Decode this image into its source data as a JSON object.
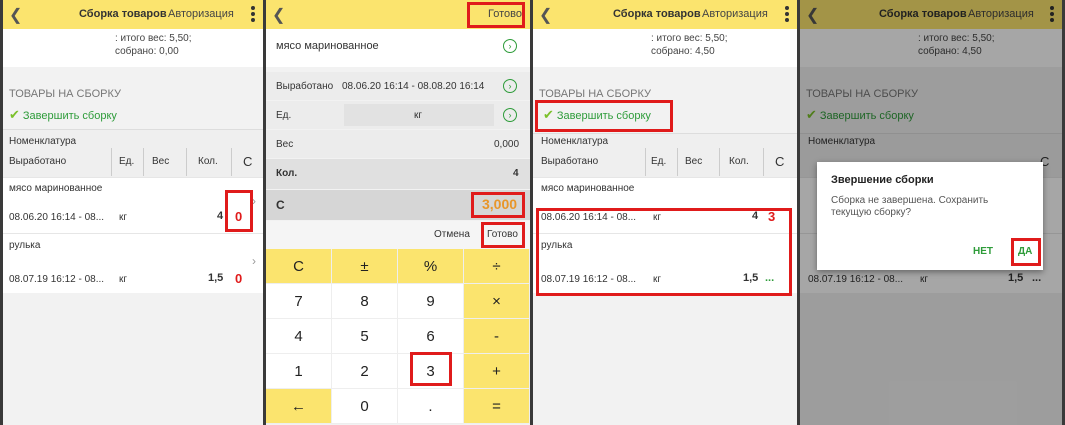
{
  "header": {
    "title": "Сборка товаров",
    "auth": "Авторизация",
    "done": "Готово"
  },
  "summary_before": {
    "line1": ": итого вес: 5,50;",
    "line2": "собрано: 0,00"
  },
  "summary_after": {
    "line1": ": итого вес: 5,50;",
    "line2": "собрано: 4,50"
  },
  "section_title": "ТОВАРЫ НА СБОРКУ",
  "finish_label": "Завершить сборку",
  "columns": {
    "nomenclature": "Номенклатура",
    "produced": "Выработано",
    "unit": "Ед.",
    "weight": "Вес",
    "qty": "Кол.",
    "c": "С"
  },
  "items": [
    {
      "name": "мясо маринованное",
      "period": "08.06.20 16:14 - 08...",
      "unit": "кг",
      "qty": "4",
      "collected_before": "0",
      "collected_after": "3"
    },
    {
      "name": "рулька",
      "period": "08.07.19 16:12 - 08...",
      "unit": "кг",
      "qty": "1,5",
      "collected_before": "0",
      "collected_after": "..."
    }
  ],
  "calc": {
    "product": "мясо маринованное",
    "produced_label": "Выработано",
    "produced_value": "08.06.20 16:14 - 08.08.20 16:14",
    "unit_label": "Ед.",
    "unit_value": "кг",
    "weight_label": "Вес",
    "weight_value": "0,000",
    "qty_label": "Кол.",
    "qty_value": "4",
    "c_label": "С",
    "c_value": "3,000",
    "cancel": "Отмена",
    "done": "Готово",
    "keys": [
      "С",
      "±",
      "%",
      "÷",
      "7",
      "8",
      "9",
      "×",
      "4",
      "5",
      "6",
      "-",
      "1",
      "2",
      "3",
      "+",
      "←",
      "0",
      ".",
      "="
    ]
  },
  "dialog": {
    "title": "Звершение сборки",
    "message": "Сборка не завершена. Сохранить текущую сборку?",
    "no": "НЕТ",
    "yes": "ДА"
  },
  "colors": {
    "accent": "#fbe46e",
    "green": "#2e9c3a",
    "red": "#e01b1b",
    "orange": "#e8962a"
  },
  "icons": {
    "back": "chevron-left-icon",
    "menu": "more-vert-icon",
    "check": "check-icon",
    "arrow": "chevron-right-circle-icon"
  }
}
